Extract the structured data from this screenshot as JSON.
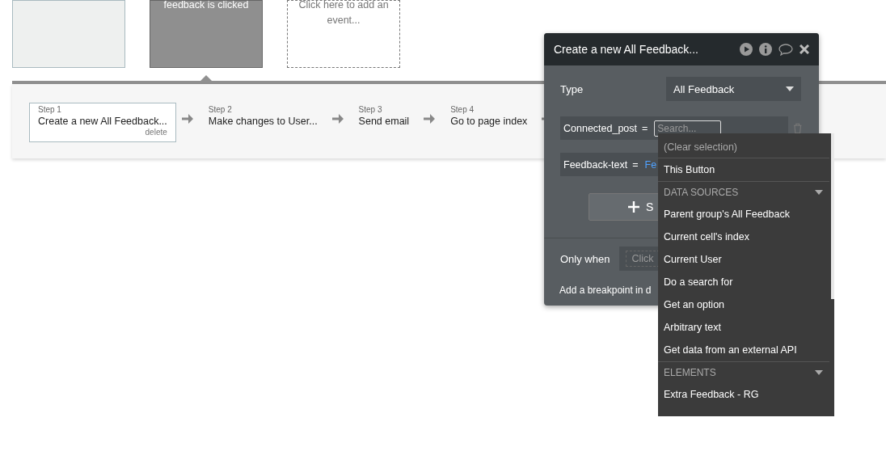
{
  "event_cards": [
    {
      "kind": "event",
      "selected": false
    },
    {
      "kind": "event",
      "selected": true,
      "label": "feedback is clicked"
    },
    {
      "kind": "add",
      "label": "Click here to add an event..."
    }
  ],
  "steps": [
    {
      "number": "Step 1",
      "title": "Create a new All Feedback...",
      "selected": true,
      "delete": "delete"
    },
    {
      "number": "Step 2",
      "title": "Make changes to User...",
      "selected": false
    },
    {
      "number": "Step 3",
      "title": "Send email",
      "selected": false
    },
    {
      "number": "Step 4",
      "title": "Go to page index",
      "selected": false
    }
  ],
  "panel": {
    "title": "Create a new All Feedback...",
    "type_label": "Type",
    "type_value": "All Feedback",
    "fields": [
      {
        "name": "Connected_post",
        "operator": "=",
        "kind": "search",
        "placeholder": "Search..."
      },
      {
        "name": "Feedback-text",
        "operator": "=",
        "kind": "value",
        "value": "Fe"
      }
    ],
    "button_label": "S",
    "only_when": "Only when",
    "condition_placeholder": "Click",
    "breakpoint": "Add a breakpoint in d"
  },
  "dropdown": {
    "items": [
      {
        "kind": "clear",
        "label": "(Clear selection)"
      },
      {
        "kind": "option",
        "label": "This Button"
      },
      {
        "kind": "section",
        "label": "DATA SOURCES"
      },
      {
        "kind": "option",
        "label": "Parent group's All Feedback"
      },
      {
        "kind": "option",
        "label": "Current cell's index"
      },
      {
        "kind": "option",
        "label": "Current User"
      },
      {
        "kind": "option",
        "label": "Do a search for"
      },
      {
        "kind": "option",
        "label": "Get an option"
      },
      {
        "kind": "option",
        "label": "Arbitrary text"
      },
      {
        "kind": "option",
        "label": "Get data from an external API"
      },
      {
        "kind": "section",
        "label": "ELEMENTS"
      },
      {
        "kind": "option",
        "label": "Extra Feedback - RG"
      }
    ]
  }
}
